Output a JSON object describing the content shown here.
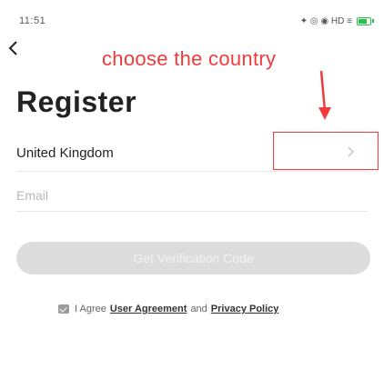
{
  "status_bar": {
    "time": "11:51",
    "icons_text": "✦ ◎ ◉ HD ≡"
  },
  "annotation": {
    "text": "choose the country",
    "color": "#ef3b3b"
  },
  "header": {
    "title": "Register"
  },
  "form": {
    "country": "United Kingdom",
    "email_placeholder": "Email",
    "email_value": "",
    "get_code_label": "Get Verification Code"
  },
  "agreement": {
    "prefix": "I Agree",
    "user_agreement": "User Agreement",
    "and": "and",
    "privacy_policy": "Privacy Policy",
    "checked": true
  },
  "icons": {
    "back": "back-arrow-icon",
    "chevron": "chevron-right-icon",
    "checkbox": "checkbox-icon",
    "battery": "battery-icon"
  },
  "colors": {
    "button_disabled": "#dcdcdc",
    "battery": "#27c24c",
    "text": "#222222"
  }
}
